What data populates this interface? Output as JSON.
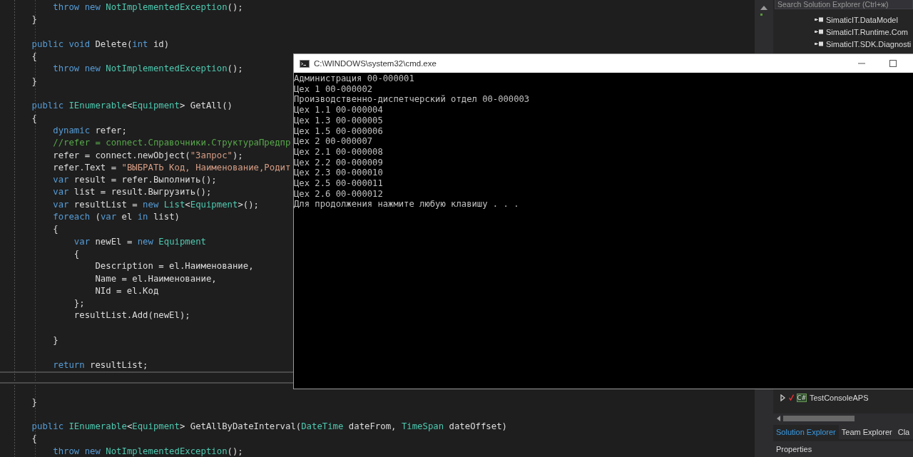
{
  "editor": {
    "lines": [
      {
        "tokens": [
          {
            "kind": "keyword",
            "text": "        throw new "
          },
          {
            "kind": "type",
            "text": "NotImplementedException"
          },
          {
            "kind": "plain",
            "text": "();"
          }
        ]
      },
      {
        "tokens": [
          {
            "kind": "plain",
            "text": "    }"
          }
        ]
      },
      {
        "kind": "blank"
      },
      {
        "tokens": [
          {
            "kind": "keyword",
            "text": "    public void "
          },
          {
            "kind": "plain",
            "text": "Delete("
          },
          {
            "kind": "keyword",
            "text": "int "
          },
          {
            "kind": "plain",
            "text": "id)"
          }
        ]
      },
      {
        "tokens": [
          {
            "kind": "plain",
            "text": "    {"
          }
        ]
      },
      {
        "tokens": [
          {
            "kind": "keyword",
            "text": "        throw new "
          },
          {
            "kind": "type",
            "text": "NotImplementedException"
          },
          {
            "kind": "plain",
            "text": "();"
          }
        ]
      },
      {
        "tokens": [
          {
            "kind": "plain",
            "text": "    }"
          }
        ]
      },
      {
        "kind": "blank"
      },
      {
        "tokens": [
          {
            "kind": "keyword",
            "text": "    public "
          },
          {
            "kind": "type",
            "text": "IEnumerable"
          },
          {
            "kind": "plain",
            "text": "<"
          },
          {
            "kind": "type",
            "text": "Equipment"
          },
          {
            "kind": "plain",
            "text": "> GetAll()"
          }
        ]
      },
      {
        "tokens": [
          {
            "kind": "plain",
            "text": "    {"
          }
        ]
      },
      {
        "tokens": [
          {
            "kind": "keyword",
            "text": "        dynamic "
          },
          {
            "kind": "plain",
            "text": "refer;"
          }
        ]
      },
      {
        "tokens": [
          {
            "kind": "comment",
            "text": "        //refer = connect.Справочники.СтруктураПредпр"
          }
        ]
      },
      {
        "tokens": [
          {
            "kind": "plain",
            "text": "        refer = connect.newObject("
          },
          {
            "kind": "string",
            "text": "\"Запрос\""
          },
          {
            "kind": "plain",
            "text": ");"
          }
        ]
      },
      {
        "tokens": [
          {
            "kind": "plain",
            "text": "        refer.Text = "
          },
          {
            "kind": "string",
            "text": "\"ВЫБРАТЬ Код, Наименование,Родит"
          }
        ]
      },
      {
        "tokens": [
          {
            "kind": "keyword",
            "text": "        var "
          },
          {
            "kind": "plain",
            "text": "result = refer.Выполнить();"
          }
        ]
      },
      {
        "tokens": [
          {
            "kind": "keyword",
            "text": "        var "
          },
          {
            "kind": "plain",
            "text": "list = result.Выгрузить();"
          }
        ]
      },
      {
        "tokens": [
          {
            "kind": "keyword",
            "text": "        var "
          },
          {
            "kind": "plain",
            "text": "resultList = "
          },
          {
            "kind": "keyword",
            "text": "new "
          },
          {
            "kind": "type",
            "text": "List"
          },
          {
            "kind": "plain",
            "text": "<"
          },
          {
            "kind": "type",
            "text": "Equipment"
          },
          {
            "kind": "plain",
            "text": ">();"
          }
        ]
      },
      {
        "tokens": [
          {
            "kind": "keyword",
            "text": "        foreach "
          },
          {
            "kind": "plain",
            "text": "("
          },
          {
            "kind": "keyword",
            "text": "var "
          },
          {
            "kind": "plain",
            "text": "el "
          },
          {
            "kind": "keyword",
            "text": "in "
          },
          {
            "kind": "plain",
            "text": "list)"
          }
        ]
      },
      {
        "tokens": [
          {
            "kind": "plain",
            "text": "        {"
          }
        ]
      },
      {
        "tokens": [
          {
            "kind": "keyword",
            "text": "            var "
          },
          {
            "kind": "plain",
            "text": "newEl = "
          },
          {
            "kind": "keyword",
            "text": "new "
          },
          {
            "kind": "type",
            "text": "Equipment"
          }
        ]
      },
      {
        "tokens": [
          {
            "kind": "plain",
            "text": "            {"
          }
        ]
      },
      {
        "tokens": [
          {
            "kind": "plain",
            "text": "                Description = el.Наименование,"
          }
        ]
      },
      {
        "tokens": [
          {
            "kind": "plain",
            "text": "                Name = el.Наименование,"
          }
        ]
      },
      {
        "tokens": [
          {
            "kind": "plain",
            "text": "                NId = el.Код"
          }
        ]
      },
      {
        "tokens": [
          {
            "kind": "plain",
            "text": "            };"
          }
        ]
      },
      {
        "tokens": [
          {
            "kind": "plain",
            "text": "            resultList.Add(newEl);"
          }
        ]
      },
      {
        "kind": "blank"
      },
      {
        "tokens": [
          {
            "kind": "plain",
            "text": "        }"
          }
        ]
      },
      {
        "kind": "blank"
      },
      {
        "tokens": [
          {
            "kind": "keyword",
            "text": "        return "
          },
          {
            "kind": "plain",
            "text": "resultList;"
          }
        ]
      },
      {
        "kind": "current"
      },
      {
        "kind": "blank"
      },
      {
        "tokens": [
          {
            "kind": "plain",
            "text": "    }"
          }
        ]
      },
      {
        "kind": "blank"
      },
      {
        "tokens": [
          {
            "kind": "keyword",
            "text": "    public "
          },
          {
            "kind": "type",
            "text": "IEnumerable"
          },
          {
            "kind": "plain",
            "text": "<"
          },
          {
            "kind": "type",
            "text": "Equipment"
          },
          {
            "kind": "plain",
            "text": "> GetAllByDateInterval("
          },
          {
            "kind": "type",
            "text": "DateTime "
          },
          {
            "kind": "plain",
            "text": "dateFrom, "
          },
          {
            "kind": "type",
            "text": "TimeSpan "
          },
          {
            "kind": "plain",
            "text": "dateOffset)"
          }
        ]
      },
      {
        "tokens": [
          {
            "kind": "plain",
            "text": "    {"
          }
        ]
      },
      {
        "tokens": [
          {
            "kind": "keyword",
            "text": "        throw new "
          },
          {
            "kind": "type",
            "text": "NotImplementedException"
          },
          {
            "kind": "plain",
            "text": "();"
          }
        ]
      }
    ]
  },
  "solution_explorer": {
    "search": {
      "placeholder": "Search Solution Explorer (Ctrl+ж)"
    },
    "items": [
      {
        "kind": "reference",
        "label": "SimaticIT.DataModel"
      },
      {
        "kind": "reference",
        "label": "SimaticIT.Runtime.Com"
      },
      {
        "kind": "reference",
        "label": "SimaticIT.SDK.Diagnosti"
      },
      {
        "kind": "project",
        "label": "TestConsoleAPS",
        "icon_label": "C#",
        "expanded": false
      }
    ],
    "tabs": [
      {
        "label": "Solution Explorer",
        "selected": true
      },
      {
        "label": "Team Explorer",
        "selected": false
      },
      {
        "label": "Cla",
        "selected": false
      }
    ]
  },
  "properties": {
    "title": "Properties"
  },
  "console": {
    "title": "C:\\WINDOWS\\system32\\cmd.exe",
    "lines": [
      "Администрация 00-000001",
      "Цех 1 00-000002",
      "Производственно-диспетчерский отдел 00-000003",
      "Цех 1.1 00-000004",
      "Цех 1.3 00-000005",
      "Цех 1.5 00-000006",
      "Цех 2 00-000007",
      "Цех 2.1 00-000008",
      "Цех 2.2 00-000009",
      "Цех 2.3 00-000010",
      "Цех 2.5 00-000011",
      "Цех 2.6 00-000012",
      "Для продолжения нажмите любую клавишу . . ."
    ]
  }
}
